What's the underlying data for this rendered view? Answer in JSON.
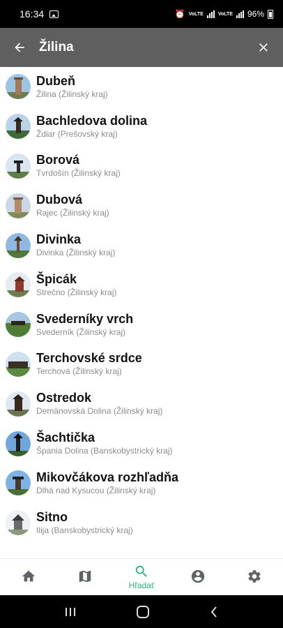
{
  "status": {
    "time": "16:34",
    "volte1": "VoLTE",
    "volte2": "VoLTE",
    "battery": "96%"
  },
  "header": {
    "title": "Žilina"
  },
  "results": [
    {
      "name": "Dubeň",
      "location": "Žilina (Žilinský kraj)"
    },
    {
      "name": "Bachledova dolina",
      "location": "Ždiar (Prešovský kraj)"
    },
    {
      "name": "Borová",
      "location": "Tvrdošín (Žilinský kraj)"
    },
    {
      "name": "Dubová",
      "location": "Rajec (Žilinský kraj)"
    },
    {
      "name": "Divinka",
      "location": "Divinka (Žilinský kraj)"
    },
    {
      "name": "Špicák",
      "location": "Strečno (Žilinský kraj)"
    },
    {
      "name": "Svederníky vrch",
      "location": "Svederník (Žilinský kraj)"
    },
    {
      "name": "Terchovské srdce",
      "location": "Terchová (Žilinský kraj)"
    },
    {
      "name": "Ostredok",
      "location": "Demänovská Dolina (Žilinský kraj)"
    },
    {
      "name": "Šachtička",
      "location": "Špania Dolina (Banskobystrický kraj)"
    },
    {
      "name": "Mikovčákova rozhľadňa",
      "location": "Dlhá nad Kysucou (Žilinský kraj)"
    },
    {
      "name": "Sitno",
      "location": "Ilija (Banskobystrický kraj)"
    }
  ],
  "bottom_nav": {
    "items": [
      {
        "icon": "home-icon",
        "label": ""
      },
      {
        "icon": "map-icon",
        "label": ""
      },
      {
        "icon": "search-icon",
        "label": "Hľadať"
      },
      {
        "icon": "account-icon",
        "label": ""
      },
      {
        "icon": "settings-icon",
        "label": ""
      }
    ],
    "active_color": "#2bb37c",
    "inactive_color": "#5f6368"
  },
  "colors": {
    "app_bar": "#5f5f5f",
    "accent": "#2bb37c"
  }
}
